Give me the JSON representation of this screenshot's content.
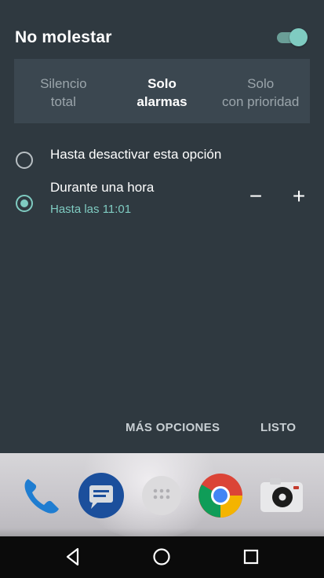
{
  "panel": {
    "title": "No molestar",
    "toggle_on": true,
    "accent_color": "#7fcbc1",
    "background_color": "#2f3940"
  },
  "tabs": [
    {
      "label": "Silencio\ntotal",
      "selected": false
    },
    {
      "label": "Solo\nalarmas",
      "selected": true
    },
    {
      "label": "Solo\ncon prioridad",
      "selected": false
    }
  ],
  "options": [
    {
      "label": "Hasta desactivar esta opción",
      "checked": false
    },
    {
      "label": "Durante una hora",
      "sublabel": "Hasta las 11:01",
      "checked": true
    }
  ],
  "stepper": {
    "decrease": "−",
    "increase": "+"
  },
  "actions": {
    "more_options": "MÁS OPCIONES",
    "done": "LISTO"
  },
  "dock": {
    "icons": [
      "phone-icon",
      "messages-icon",
      "app-drawer-icon",
      "chrome-icon",
      "camera-icon"
    ]
  },
  "nav": {
    "buttons": [
      "back-icon",
      "home-icon",
      "recents-icon"
    ]
  }
}
